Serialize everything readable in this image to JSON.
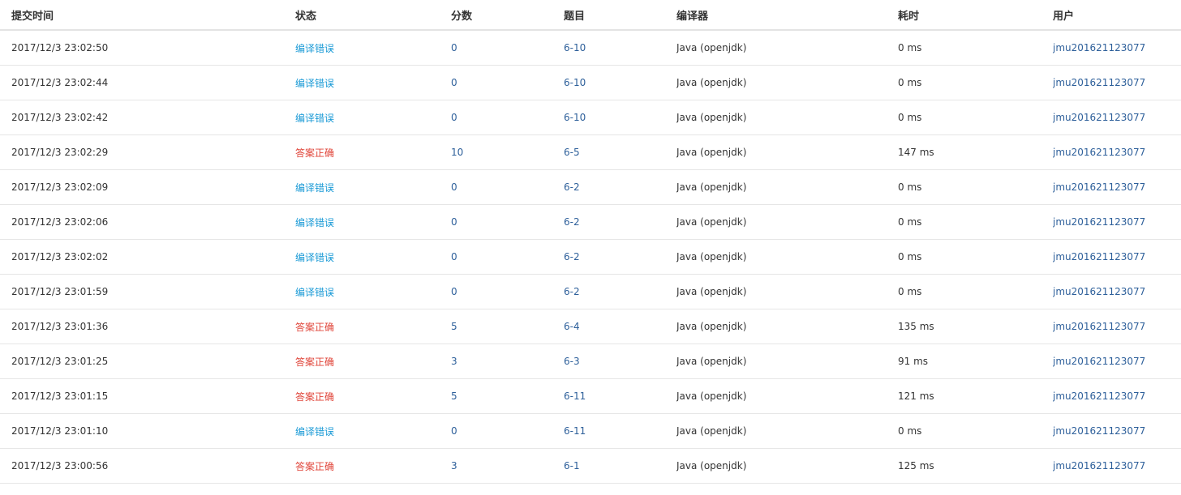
{
  "table": {
    "headers": {
      "time": "提交时间",
      "status": "状态",
      "score": "分数",
      "problem": "题目",
      "compiler": "编译器",
      "elapsed": "耗时",
      "user": "用户"
    },
    "rows": [
      {
        "time": "2017/12/3 23:02:50",
        "status": "编译错误",
        "status_type": "ce",
        "score": "0",
        "problem": "6-10",
        "compiler": "Java (openjdk)",
        "elapsed": "0 ms",
        "user": "jmu201621123077"
      },
      {
        "time": "2017/12/3 23:02:44",
        "status": "编译错误",
        "status_type": "ce",
        "score": "0",
        "problem": "6-10",
        "compiler": "Java (openjdk)",
        "elapsed": "0 ms",
        "user": "jmu201621123077"
      },
      {
        "time": "2017/12/3 23:02:42",
        "status": "编译错误",
        "status_type": "ce",
        "score": "0",
        "problem": "6-10",
        "compiler": "Java (openjdk)",
        "elapsed": "0 ms",
        "user": "jmu201621123077"
      },
      {
        "time": "2017/12/3 23:02:29",
        "status": "答案正确",
        "status_type": "ac",
        "score": "10",
        "problem": "6-5",
        "compiler": "Java (openjdk)",
        "elapsed": "147 ms",
        "user": "jmu201621123077"
      },
      {
        "time": "2017/12/3 23:02:09",
        "status": "编译错误",
        "status_type": "ce",
        "score": "0",
        "problem": "6-2",
        "compiler": "Java (openjdk)",
        "elapsed": "0 ms",
        "user": "jmu201621123077"
      },
      {
        "time": "2017/12/3 23:02:06",
        "status": "编译错误",
        "status_type": "ce",
        "score": "0",
        "problem": "6-2",
        "compiler": "Java (openjdk)",
        "elapsed": "0 ms",
        "user": "jmu201621123077"
      },
      {
        "time": "2017/12/3 23:02:02",
        "status": "编译错误",
        "status_type": "ce",
        "score": "0",
        "problem": "6-2",
        "compiler": "Java (openjdk)",
        "elapsed": "0 ms",
        "user": "jmu201621123077"
      },
      {
        "time": "2017/12/3 23:01:59",
        "status": "编译错误",
        "status_type": "ce",
        "score": "0",
        "problem": "6-2",
        "compiler": "Java (openjdk)",
        "elapsed": "0 ms",
        "user": "jmu201621123077"
      },
      {
        "time": "2017/12/3 23:01:36",
        "status": "答案正确",
        "status_type": "ac",
        "score": "5",
        "problem": "6-4",
        "compiler": "Java (openjdk)",
        "elapsed": "135 ms",
        "user": "jmu201621123077"
      },
      {
        "time": "2017/12/3 23:01:25",
        "status": "答案正确",
        "status_type": "ac",
        "score": "3",
        "problem": "6-3",
        "compiler": "Java (openjdk)",
        "elapsed": "91 ms",
        "user": "jmu201621123077"
      },
      {
        "time": "2017/12/3 23:01:15",
        "status": "答案正确",
        "status_type": "ac",
        "score": "5",
        "problem": "6-11",
        "compiler": "Java (openjdk)",
        "elapsed": "121 ms",
        "user": "jmu201621123077"
      },
      {
        "time": "2017/12/3 23:01:10",
        "status": "编译错误",
        "status_type": "ce",
        "score": "0",
        "problem": "6-11",
        "compiler": "Java (openjdk)",
        "elapsed": "0 ms",
        "user": "jmu201621123077"
      },
      {
        "time": "2017/12/3 23:00:56",
        "status": "答案正确",
        "status_type": "ac",
        "score": "3",
        "problem": "6-1",
        "compiler": "Java (openjdk)",
        "elapsed": "125 ms",
        "user": "jmu201621123077"
      }
    ]
  },
  "colors": {
    "compile_error": "#1a9ad6",
    "accepted": "#e0453a",
    "link": "#2d5f9a"
  }
}
